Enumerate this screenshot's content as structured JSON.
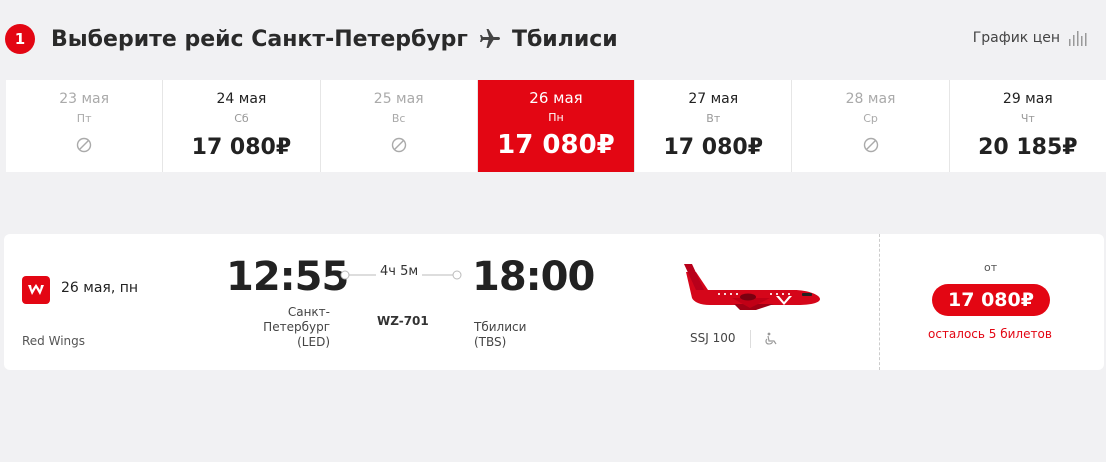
{
  "header": {
    "step_number": "1",
    "title_prefix": "Выберите рейс Санкт-Петербург",
    "destination": "Тбилиси",
    "price_chart_label": "График цен"
  },
  "dates": [
    {
      "date": "23 мая",
      "weekday": "Пт",
      "price": "",
      "available": false
    },
    {
      "date": "24 мая",
      "weekday": "Сб",
      "price": "17 080₽",
      "available": true
    },
    {
      "date": "25 мая",
      "weekday": "Вс",
      "price": "",
      "available": false
    },
    {
      "date": "26 мая",
      "weekday": "Пн",
      "price": "17 080₽",
      "available": true,
      "selected": true
    },
    {
      "date": "27 мая",
      "weekday": "Вт",
      "price": "17 080₽",
      "available": true
    },
    {
      "date": "28 мая",
      "weekday": "Ср",
      "price": "",
      "available": false
    },
    {
      "date": "29 мая",
      "weekday": "Чт",
      "price": "20 185₽",
      "available": true
    }
  ],
  "flight": {
    "date": "26 мая, пн",
    "airline": "Red Wings",
    "departure_time": "12:55",
    "departure_city": "Санкт-Петербург (LED)",
    "departure_city_line1": "Санкт-",
    "departure_city_line2": "Петербург",
    "departure_city_line3": "(LED)",
    "arrival_time": "18:00",
    "arrival_city_line1": "Тбилиси",
    "arrival_city_line2": "(TBS)",
    "duration": "4ч 5м",
    "flight_number": "WZ-701",
    "aircraft": "SSJ 100",
    "from_label": "от",
    "price": "17 080₽",
    "seats_left": "осталось 5 билетов"
  },
  "colors": {
    "accent": "#e30613",
    "background": "#f1f1f3"
  },
  "icons": [
    "step-badge",
    "plane-icon",
    "bar-chart-icon",
    "not-available-icon",
    "red-wings-logo-icon",
    "wheelchair-icon"
  ]
}
